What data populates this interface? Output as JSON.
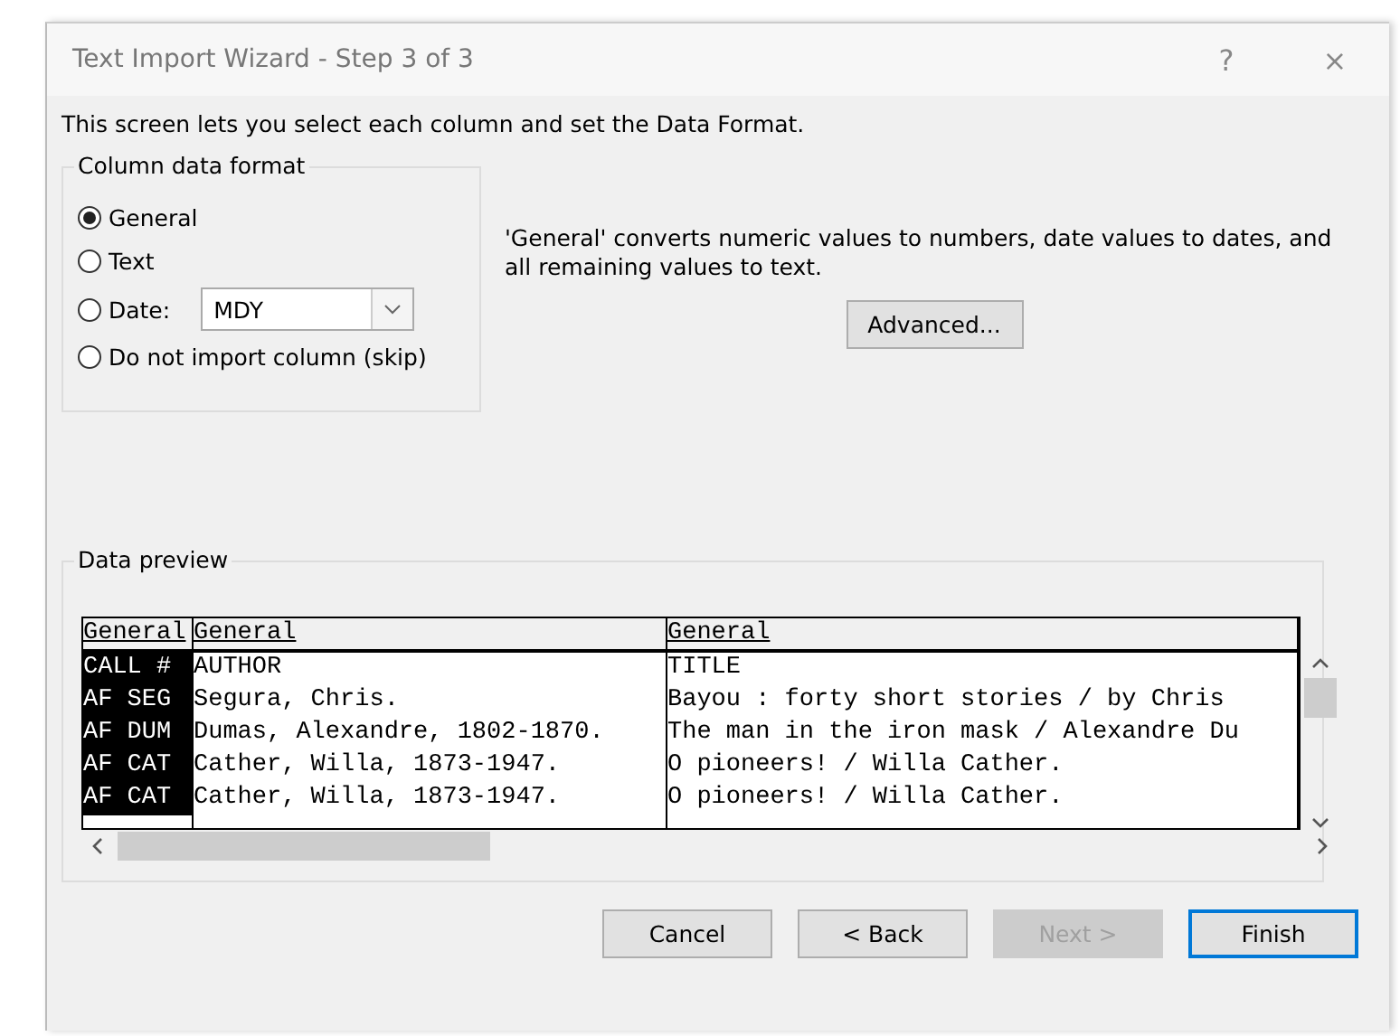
{
  "window": {
    "title": "Text Import Wizard - Step 3 of 3",
    "help": "?",
    "close": "×"
  },
  "instruction": "This screen lets you select each column and set the Data Format.",
  "column_data_format": {
    "title": "Column data format",
    "options": [
      {
        "kind": "plain",
        "label": "General",
        "selected": true
      },
      {
        "kind": "plain",
        "label": "Text",
        "selected": false
      },
      {
        "kind": "dropdown",
        "label": "Date:",
        "selected": false,
        "value": "MDY"
      },
      {
        "kind": "plain",
        "label": "Do not import column (skip)",
        "selected": false
      }
    ]
  },
  "description": "'General' converts numeric values to numbers, date values to dates, and all remaining values to text.",
  "advanced_button": {
    "label": "Advanced..."
  },
  "data_preview": {
    "title": "Data preview",
    "columns": [
      {
        "header": "General",
        "selected": true,
        "values": [
          "CALL #",
          "AF SEG",
          "AF DUM",
          "AF CAT",
          "AF CAT"
        ]
      },
      {
        "header": "General",
        "selected": false,
        "values": [
          "AUTHOR",
          "Segura, Chris.",
          "Dumas, Alexandre, 1802-1870.",
          "Cather, Willa, 1873-1947.",
          "Cather, Willa, 1873-1947."
        ]
      },
      {
        "header": "General",
        "selected": false,
        "values": [
          "TITLE",
          "Bayou : forty short stories / by Chris",
          "The man in the iron mask / Alexandre Du",
          "O pioneers! / Willa Cather.",
          "O pioneers! / Willa Cather."
        ]
      }
    ]
  },
  "buttons": [
    {
      "label": "Cancel",
      "disabled": false,
      "default": false
    },
    {
      "label": "< Back",
      "disabled": false,
      "default": false
    },
    {
      "label": "Next >",
      "disabled": true,
      "default": false
    },
    {
      "label": "Finish",
      "disabled": false,
      "default": true
    }
  ]
}
